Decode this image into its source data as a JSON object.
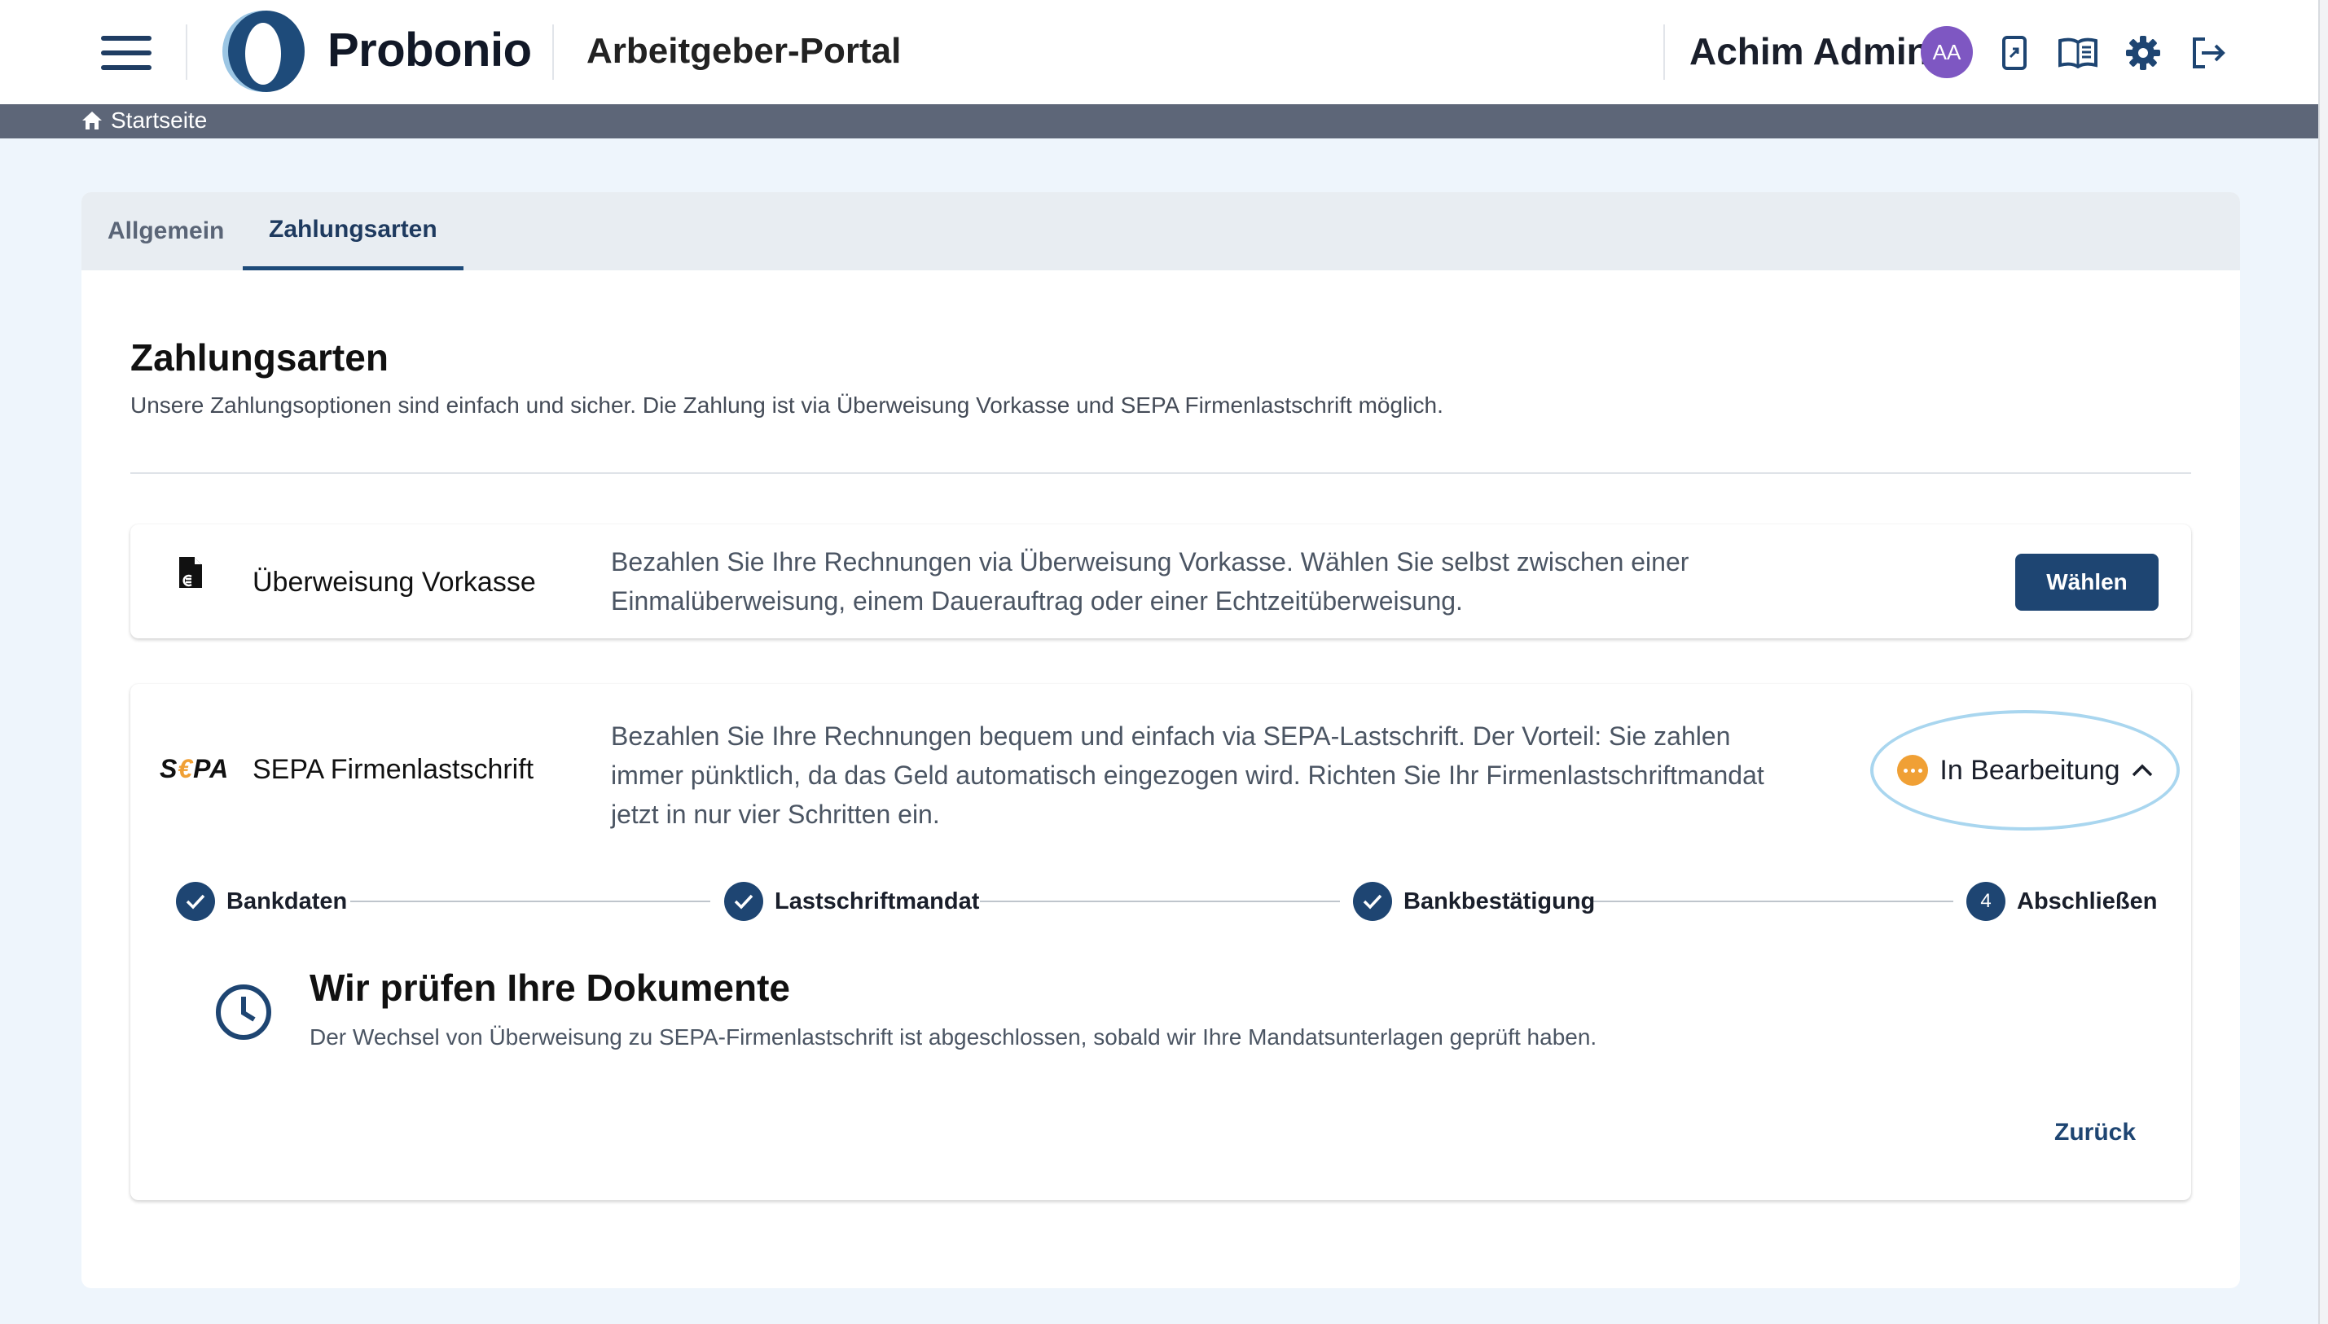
{
  "header": {
    "brand": "Probonio",
    "portal_title": "Arbeitgeber-Portal",
    "user_name": "Achim Admin",
    "avatar_initials": "AA",
    "icons": [
      "menu-icon",
      "mobile-app-icon",
      "manual-book-icon",
      "gear-icon",
      "logout-icon"
    ]
  },
  "breadcrumb": {
    "home_label": "Startseite"
  },
  "tabs": [
    {
      "label": "Allgemein",
      "active": false
    },
    {
      "label": "Zahlungsarten",
      "active": true
    }
  ],
  "section": {
    "title": "Zahlungsarten",
    "description": "Unsere Zahlungsoptionen sind einfach und sicher. Die Zahlung ist via Überweisung Vorkasse und SEPA Firmenlastschrift möglich."
  },
  "methods": {
    "transfer": {
      "name": "Überweisung Vorkasse",
      "description_line1": "Bezahlen Sie Ihre Rechnungen via Überweisung Vorkasse. Wählen Sie selbst zwischen einer",
      "description_line2": "Einmalüberweisung, einem Dauerauftrag oder einer Echtzeitüberweisung.",
      "button_label": "Wählen"
    },
    "sepa": {
      "logo_text": "SEPA",
      "name": "SEPA Firmenlastschrift",
      "description_line1": "Bezahlen Sie Ihre Rechnungen bequem und einfach via SEPA-Lastschrift. Der Vorteil: Sie zahlen",
      "description_line2": "immer pünktlich, da das Geld automatisch eingezogen wird. Richten Sie Ihr Firmenlastschriftmandat",
      "description_line3": "jetzt in nur vier Schritten ein.",
      "status": "In Bearbeitung",
      "status_color": "#f0a035",
      "steps": [
        {
          "label": "Bankdaten",
          "done": true
        },
        {
          "label": "Lastschriftmandat",
          "done": true
        },
        {
          "label": "Bankbestätigung",
          "done": true
        },
        {
          "label": "Abschließen",
          "done": false,
          "number": "4"
        }
      ],
      "review": {
        "title": "Wir prüfen Ihre Dokumente",
        "description": "Der Wechsel von Überweisung zu SEPA-Firmenlastschrift ist abgeschlossen, sobald wir Ihre Mandatsunterlagen geprüft haben."
      },
      "back_label": "Zurück"
    }
  },
  "colors": {
    "primary": "#1e4572",
    "page_bg": "#eef5fc",
    "breadcrumb_bg": "#5d6678",
    "avatar": "#7e57c2"
  }
}
